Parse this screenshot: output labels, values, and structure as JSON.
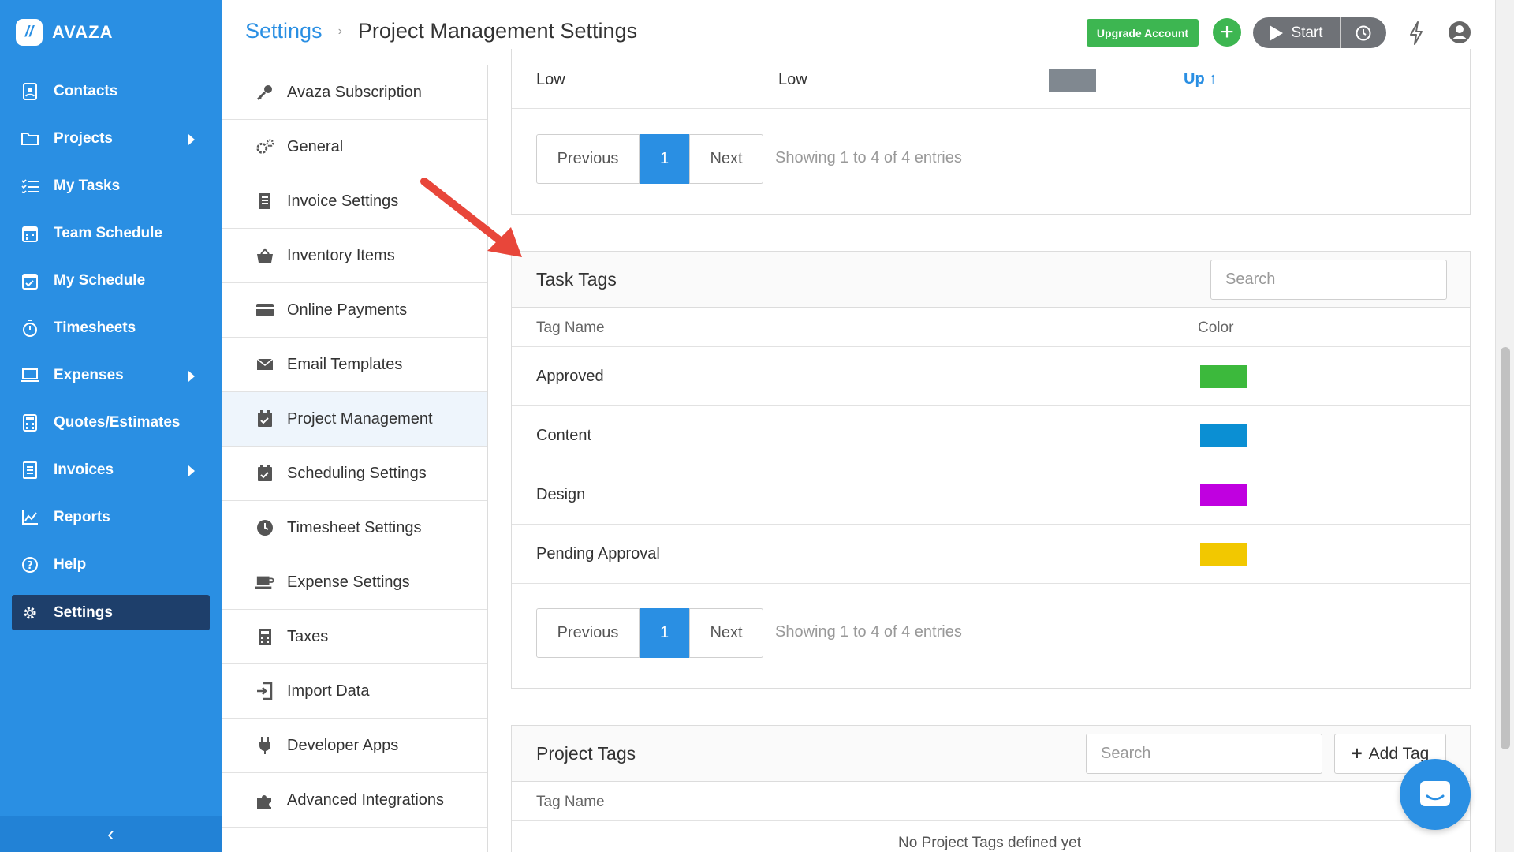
{
  "brand": {
    "name": "AVAZA"
  },
  "nav": {
    "items": [
      {
        "label": "Contacts",
        "icon": "contacts-icon",
        "has_submenu": false
      },
      {
        "label": "Projects",
        "icon": "folder-icon",
        "has_submenu": true
      },
      {
        "label": "My Tasks",
        "icon": "task-list-icon",
        "has_submenu": false
      },
      {
        "label": "Team Schedule",
        "icon": "calendar-icon",
        "has_submenu": false
      },
      {
        "label": "My Schedule",
        "icon": "calendar-check-icon",
        "has_submenu": false
      },
      {
        "label": "Timesheets",
        "icon": "stopwatch-icon",
        "has_submenu": false
      },
      {
        "label": "Expenses",
        "icon": "expense-icon",
        "has_submenu": true
      },
      {
        "label": "Quotes/Estimates",
        "icon": "calculator-icon",
        "has_submenu": false
      },
      {
        "label": "Invoices",
        "icon": "invoice-icon",
        "has_submenu": true
      },
      {
        "label": "Reports",
        "icon": "chart-icon",
        "has_submenu": false
      },
      {
        "label": "Help",
        "icon": "help-icon",
        "has_submenu": false
      },
      {
        "label": "Settings",
        "icon": "gear-icon",
        "has_submenu": false,
        "active": true
      }
    ],
    "collapse_glyph": "‹"
  },
  "header": {
    "breadcrumb_root": "Settings",
    "breadcrumb_sep": "›",
    "page_title": "Project Management Settings",
    "upgrade_label": "Upgrade Account",
    "add_glyph": "+",
    "start_label": "Start"
  },
  "settings_menu": {
    "items": [
      {
        "label": "Avaza Subscription",
        "icon": "key-icon"
      },
      {
        "label": "General",
        "icon": "gears-icon"
      },
      {
        "label": "Invoice Settings",
        "icon": "invoice-icon"
      },
      {
        "label": "Inventory Items",
        "icon": "basket-icon"
      },
      {
        "label": "Online Payments",
        "icon": "credit-card-icon"
      },
      {
        "label": "Email Templates",
        "icon": "envelope-icon"
      },
      {
        "label": "Project Management",
        "icon": "calendar-check-icon",
        "active": true
      },
      {
        "label": "Scheduling Settings",
        "icon": "calendar-check-icon"
      },
      {
        "label": "Timesheet Settings",
        "icon": "clock-icon"
      },
      {
        "label": "Expense Settings",
        "icon": "coffee-icon"
      },
      {
        "label": "Taxes",
        "icon": "calculator-icon"
      },
      {
        "label": "Import Data",
        "icon": "import-icon"
      },
      {
        "label": "Developer Apps",
        "icon": "plug-icon"
      },
      {
        "label": "Advanced Integrations",
        "icon": "puzzle-icon"
      }
    ]
  },
  "priority_row": {
    "name": "Low",
    "level": "Low",
    "swatch_color": "#808890",
    "move_label": "Up"
  },
  "pager_top": {
    "prev": "Previous",
    "page": "1",
    "next": "Next",
    "showing": "Showing 1 to 4 of 4 entries"
  },
  "task_tags": {
    "title": "Task Tags",
    "search_placeholder": "Search",
    "col_name": "Tag Name",
    "col_color": "Color",
    "rows": [
      {
        "name": "Approved",
        "color": "#3cb93c"
      },
      {
        "name": "Content",
        "color": "#0b8fd3"
      },
      {
        "name": "Design",
        "color": "#c000e0"
      },
      {
        "name": "Pending Approval",
        "color": "#f2c800"
      }
    ],
    "pager": {
      "prev": "Previous",
      "page": "1",
      "next": "Next",
      "showing": "Showing 1 to 4 of 4 entries"
    }
  },
  "project_tags": {
    "title": "Project Tags",
    "search_placeholder": "Search",
    "add_label": "Add Tag",
    "col_name": "Tag Name",
    "empty_text": "No Project Tags defined yet"
  },
  "colors": {
    "brand_blue": "#2a8fe3",
    "nav_active": "#1e3f6b",
    "green": "#3db651"
  }
}
